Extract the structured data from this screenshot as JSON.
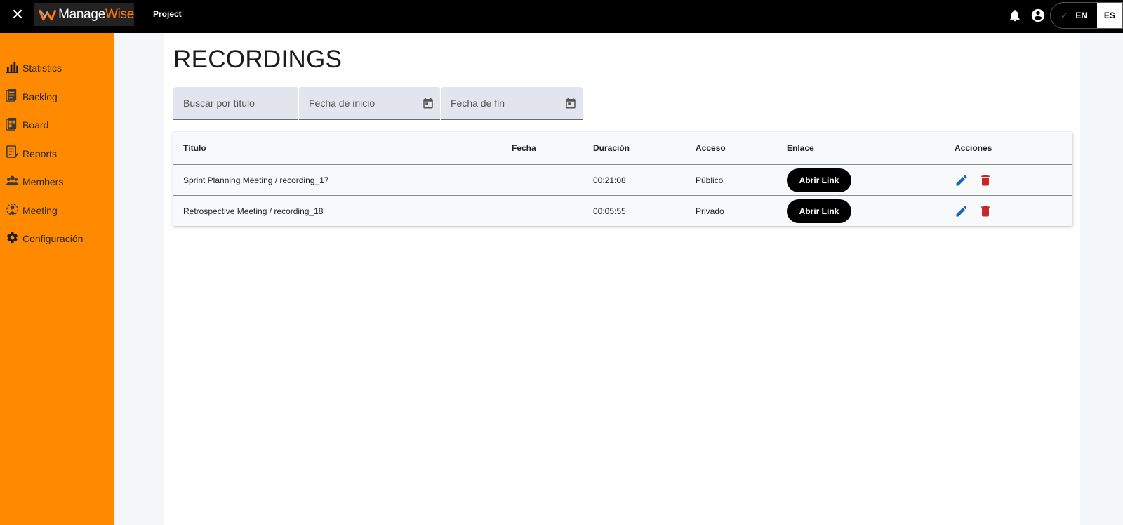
{
  "header": {
    "close_icon": "close-icon",
    "logo": {
      "part1": "Manage",
      "part2": "Wise"
    },
    "project_link": "Project",
    "notifications_icon": "bell-icon",
    "account_icon": "account-circle-icon",
    "language": {
      "en": "EN",
      "es": "ES",
      "selected": "ES"
    }
  },
  "sidebar": {
    "items": [
      {
        "label": "Statistics",
        "icon": "bar-chart-icon"
      },
      {
        "label": "Backlog",
        "icon": "backlog-icon"
      },
      {
        "label": "Board",
        "icon": "board-icon"
      },
      {
        "label": "Reports",
        "icon": "reports-icon"
      },
      {
        "label": "Members",
        "icon": "members-icon"
      },
      {
        "label": "Meeting",
        "icon": "meeting-icon"
      },
      {
        "label": "Configuración",
        "icon": "gear-icon"
      }
    ]
  },
  "main": {
    "title": "RECORDINGS",
    "filters": {
      "search_placeholder": "Buscar por título",
      "start_placeholder": "Fecha de inicio",
      "end_placeholder": "Fecha de fin"
    },
    "table": {
      "headers": {
        "titulo": "Título",
        "fecha": "Fecha",
        "duracion": "Duración",
        "acceso": "Acceso",
        "enlace": "Enlace",
        "acciones": "Acciones"
      },
      "rows": [
        {
          "titulo": "Sprint Planning Meeting / recording_17",
          "fecha": "",
          "duracion": "00:21:08",
          "acceso": "Público",
          "enlace": "Abrir Link"
        },
        {
          "titulo": "Retrospective Meeting / recording_18",
          "fecha": "",
          "duracion": "00:05:55",
          "acceso": "Privado",
          "enlace": "Abrir Link"
        }
      ]
    }
  },
  "colors": {
    "topbar": "#000000",
    "sidebar": "#ff8a00",
    "accent_orange": "#ff7a12",
    "edit_icon": "#1565c0",
    "delete_icon": "#c62828"
  }
}
